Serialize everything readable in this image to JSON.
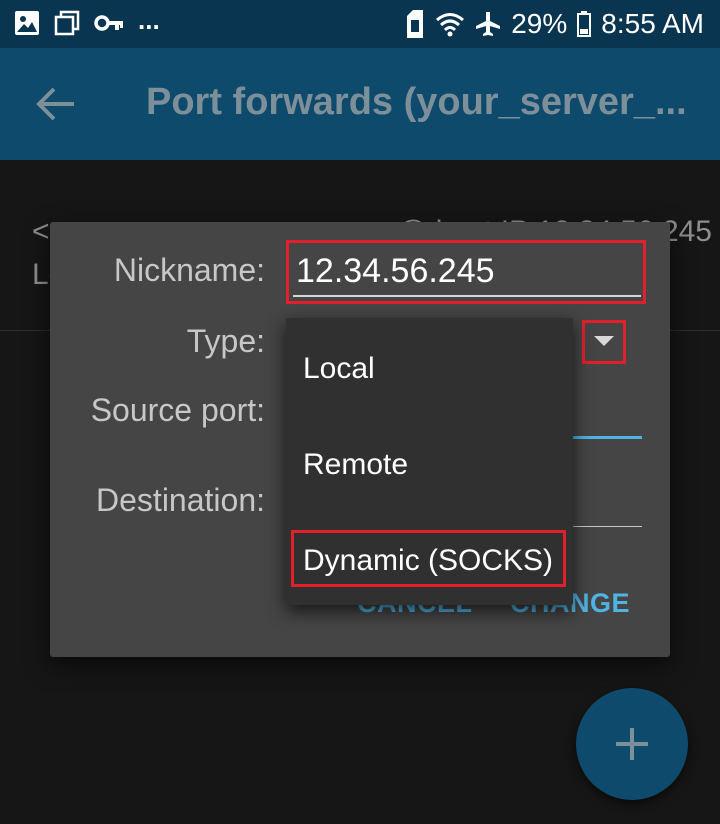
{
  "status_bar": {
    "left_icons": [
      "image-icon",
      "recents-icon",
      "key-icon"
    ],
    "overflow": "...",
    "battery": "29%",
    "time": "8:55 AM"
  },
  "toolbar": {
    "title": "Port forwards (your_server_..."
  },
  "background_list": {
    "item_left": "<y",
    "item_right": "@ host IP 12.34.56.245",
    "item_line2": "Lo"
  },
  "dialog": {
    "nickname_label": "Nickname:",
    "nickname_value": "12.34.56.245",
    "type_label": "Type:",
    "source_port_label": "Source port:",
    "destination_label": "Destination:",
    "cancel_button": "CANCEL",
    "change_button": "CHANGE"
  },
  "dropdown": {
    "options": [
      "Local",
      "Remote",
      "Dynamic (SOCKS)"
    ],
    "highlighted": "Dynamic (SOCKS)"
  },
  "colors": {
    "status_bar": "#0a3550",
    "toolbar": "#0d4a6c",
    "accent": "#4fb4e4",
    "highlight_box": "#e0202c"
  }
}
